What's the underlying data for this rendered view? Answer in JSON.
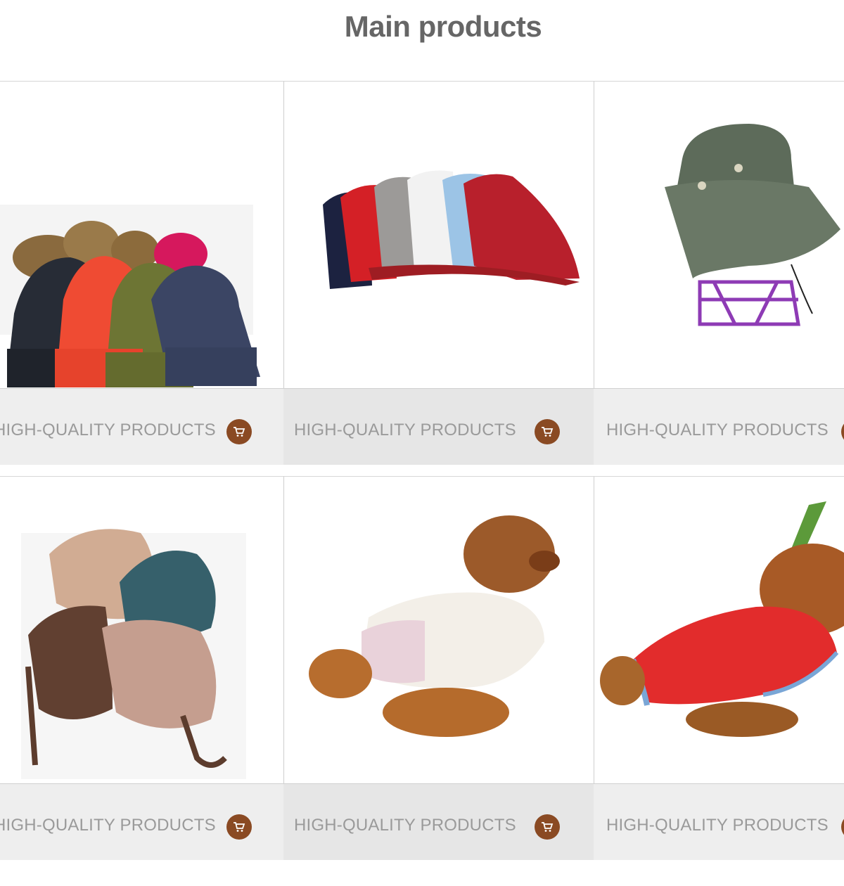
{
  "page": {
    "title": "Main products"
  },
  "colors": {
    "title": "#666666",
    "label": "#9a9a9a",
    "bar": "#eeeeee",
    "bar_alt": "#e6e6e6",
    "cart_button": "#8a4a23"
  },
  "products": [
    {
      "label": "HIGH-QUALITY PRODUCTS",
      "image": "pom-pom-knit-beanies",
      "cart_icon": "cart-icon"
    },
    {
      "label": "HIGH-QUALITY PRODUCTS",
      "image": "baseball-caps",
      "cart_icon": "cart-icon"
    },
    {
      "label": "HIGH-QUALITY PRODUCTS",
      "image": "green-bucket-hat",
      "cart_icon": "cart-icon"
    },
    {
      "label": "HIGH-QUALITY PRODUCTS",
      "image": "knit-dog-hoods",
      "cart_icon": "cart-icon"
    },
    {
      "label": "HIGH-QUALITY PRODUCTS",
      "image": "dog-in-hoodie",
      "cart_icon": "cart-icon"
    },
    {
      "label": "HIGH-QUALITY PRODUCTS",
      "image": "dog-in-red-coat",
      "cart_icon": "cart-icon"
    }
  ]
}
